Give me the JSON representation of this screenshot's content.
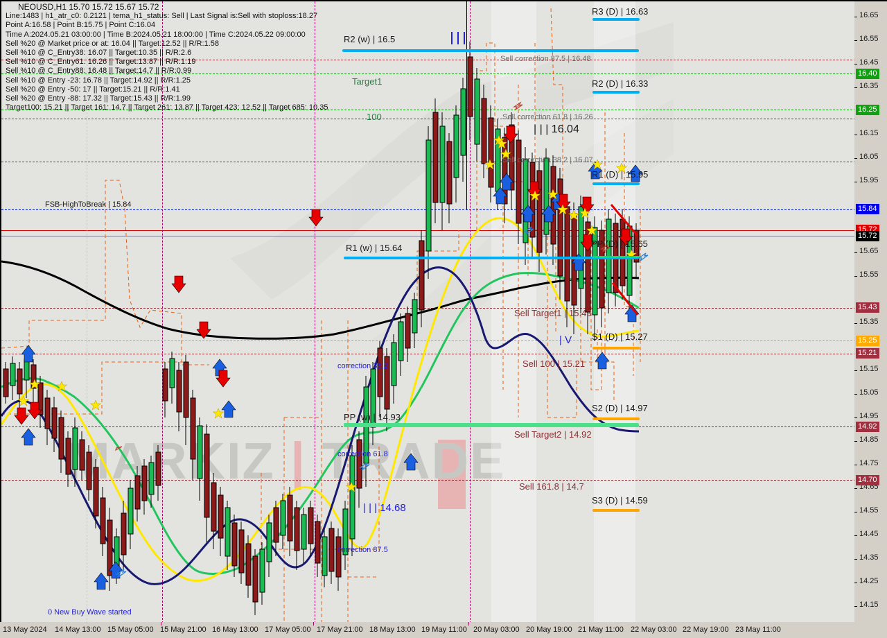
{
  "header": {
    "lines": [
      "NEOUSD,H1  15.70 15.72 15.67 15.72",
      "Line:1483 | h1_atr_c0: 0.2121 |  tema_h1_status: Sell  | Last Signal is:Sell with stoploss:18.27",
      "Point A:16.58 |  Point B:15.75 |  Point C:16.04",
      "Time A:2024.05.21 03:00:00 | Time B:2024.05.21 18:00:00 | Time C:2024.05.22 09:00:00",
      "Sell %20 @ Market price or at: 16.04 || Target:12.52 || R/R:1.58",
      "Sell %10 @ C_Entry38: 16.07 || Target:10.35 || R/R:2.6",
      "Sell %10 @ C_Entry61: 16.26 || Target:13.87 || R/R:1.19",
      "Sell %10 @ C_Entry88: 16.48 || Target:14.7 || R/R:0.99",
      "Sell %10 @ Entry -23: 16.78 || Target:14.92 || R/R:1.25",
      "Sell %20 @ Entry -50: 17 || Target:15.21 || R/R:1.41",
      "Sell %20 @ Entry -88: 17.32 || Target:15.43 || R/R:1.99",
      "Target100: 15.21 || Target 161: 14.7 || Target 261: 13.87 || Target 423: 12.52 || Target 685: 10.35"
    ]
  },
  "watermark": {
    "text1": "MARKIZ",
    "text2": "TRADE"
  },
  "chart_data": {
    "type": "line",
    "title": "NEOUSD,H1",
    "symbol": "NEOUSD",
    "timeframe": "H1",
    "ohlc": {
      "open": 15.7,
      "high": 15.72,
      "low": 15.67,
      "close": 15.72
    },
    "ylim": [
      14.1,
      16.7
    ],
    "ylabel": "",
    "xlabel": "",
    "grid": true,
    "y_ticks": [
      16.65,
      16.55,
      16.45,
      16.35,
      16.15,
      16.05,
      15.95,
      15.65,
      15.55,
      15.35,
      15.15,
      15.05,
      14.95,
      14.85,
      14.75,
      14.65,
      14.55,
      14.45,
      14.35,
      14.25,
      14.15
    ],
    "x_ticks": [
      "13 May 2024",
      "14 May 13:00",
      "15 May 05:00",
      "15 May 21:00",
      "16 May 13:00",
      "17 May 05:00",
      "17 May 21:00",
      "18 May 13:00",
      "19 May 11:00",
      "20 May 03:00",
      "20 May 19:00",
      "21 May 11:00",
      "22 May 03:00",
      "22 May 19:00",
      "23 May 11:00"
    ],
    "price_labels": [
      {
        "value": "16.40",
        "color": "#10a010",
        "text": "#ffffff"
      },
      {
        "value": "16.25",
        "color": "#10a010",
        "text": "#ffffff"
      },
      {
        "value": "15.84",
        "color": "#0000ee",
        "text": "#ffffff"
      },
      {
        "value": "15.72",
        "color": "#e00000",
        "text": "#ffffff"
      },
      {
        "value": "15.72",
        "color": "#000000",
        "text": "#ffffff"
      },
      {
        "value": "15.43",
        "color": "#a03040",
        "text": "#ffffff"
      },
      {
        "value": "15.25",
        "color": "#ffaa00",
        "text": "#ffffff"
      },
      {
        "value": "15.21",
        "color": "#a03040",
        "text": "#ffffff"
      },
      {
        "value": "14.92",
        "color": "#a03040",
        "text": "#ffffff"
      },
      {
        "value": "14.70",
        "color": "#a03040",
        "text": "#ffffff"
      }
    ]
  },
  "annotations": {
    "pivots": [
      {
        "id": "r3d",
        "label": "R3 (D)  | 16.63",
        "color": "#1a1a1a",
        "bar": "#00b0f0"
      },
      {
        "id": "r2w",
        "label": "R2 (w) | 16.5",
        "color": "#1a1a1a",
        "bar": "#00b0f0"
      },
      {
        "id": "r2d",
        "label": "R2 (D) | 16.33",
        "color": "#1a1a1a",
        "bar": "#00b0f0"
      },
      {
        "id": "r1d",
        "label": "R1  (D)  | 15.95",
        "color": "#1a1a1a",
        "bar": "#00b0f0"
      },
      {
        "id": "r1w",
        "label": "R1  (w) | 15.64",
        "color": "#1a1a1a",
        "bar": "#00b0f0"
      },
      {
        "id": "ppd",
        "label": "PP (D) | 15.65",
        "color": "#1a1a1a",
        "bar": "#00e07a"
      },
      {
        "id": "ppw",
        "label": "PP (w) | 14.93",
        "color": "#1a1a1a",
        "bar": "#4ce08a"
      },
      {
        "id": "s1d",
        "label": "S1 (D) | 15.27",
        "color": "#1a1a1a",
        "bar": "#ffa500"
      },
      {
        "id": "s2d",
        "label": "S2 (D) | 14.97",
        "color": "#1a1a1a",
        "bar": "#ffa500"
      },
      {
        "id": "s3d",
        "label": "S3 (D) | 14.59",
        "color": "#1a1a1a",
        "bar": "#ffa500"
      }
    ],
    "sell_levels": [
      {
        "id": "sc875",
        "label": "Sell correction 87.5 | 16.48"
      },
      {
        "id": "sc618",
        "label": "Sell correction 61.8 | 16.26"
      },
      {
        "id": "sc382",
        "label": "Sell correction 38.2 | 16.07"
      },
      {
        "id": "st1",
        "label": "Sell Target1 | 15.43"
      },
      {
        "id": "s100",
        "label": "Sell 100 | 15.21"
      },
      {
        "id": "st2",
        "label": "Sell Target2 | 14.92"
      },
      {
        "id": "s1618",
        "label": "Sell 161.8 | 14.7"
      }
    ],
    "fib_green": [
      {
        "id": "target1",
        "label": "Target1"
      },
      {
        "id": "fib100",
        "label": "100"
      }
    ],
    "blue_notes": [
      {
        "id": "corr382",
        "label": "correction 38.2"
      },
      {
        "id": "corr618",
        "label": "correction 61.8"
      },
      {
        "id": "corr875",
        "label": "correction 87.5"
      },
      {
        "id": "lowmark",
        "label": "| | | 14.68"
      },
      {
        "id": "pointc",
        "label": "| | | 16.04"
      },
      {
        "id": "wavenote",
        "label": "0 New Buy Wave started"
      },
      {
        "id": "ivmark",
        "label": "| V"
      }
    ],
    "fsb": {
      "label": "FSB-HighToBreak  |  15.84"
    }
  }
}
